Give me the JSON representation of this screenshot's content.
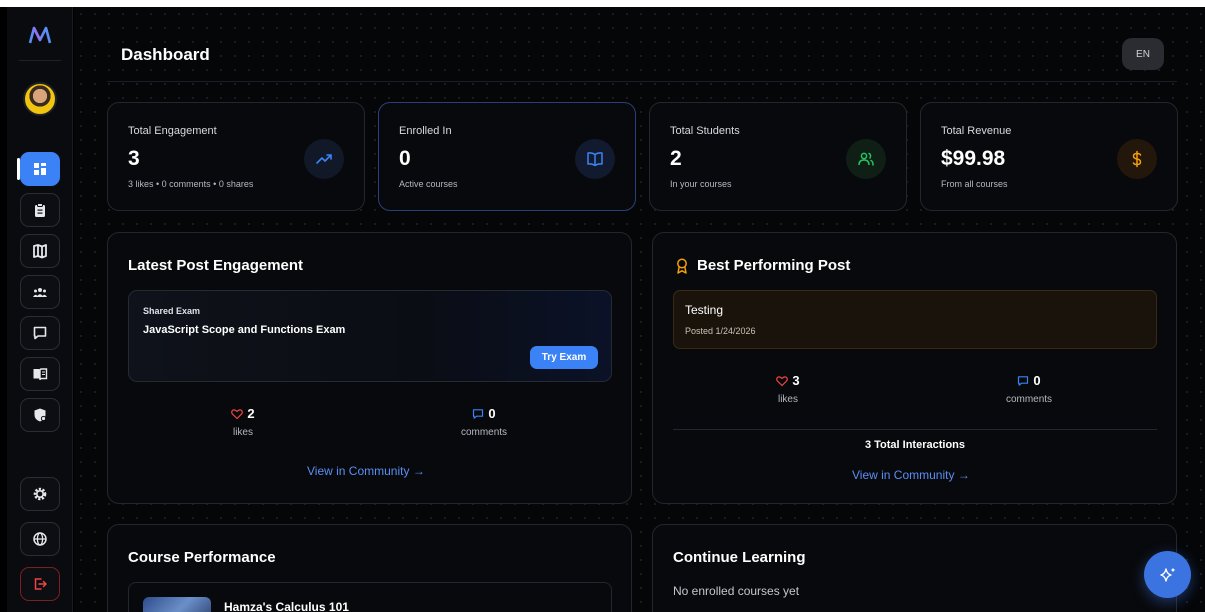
{
  "header": {
    "title": "Dashboard",
    "language": "EN"
  },
  "sidebar": {
    "items": [
      {
        "name": "dashboard",
        "icon": "grid-icon"
      },
      {
        "name": "exams",
        "icon": "clipboard-icon"
      },
      {
        "name": "roadmap",
        "icon": "map-icon"
      },
      {
        "name": "community",
        "icon": "users-icon"
      },
      {
        "name": "messages",
        "icon": "chat-icon"
      },
      {
        "name": "courses",
        "icon": "book-icon"
      },
      {
        "name": "security",
        "icon": "shield-icon"
      }
    ],
    "bottom": [
      {
        "name": "settings",
        "icon": "gear-icon"
      },
      {
        "name": "language",
        "icon": "globe-icon"
      },
      {
        "name": "logout",
        "icon": "logout-icon"
      }
    ]
  },
  "stats": [
    {
      "label": "Total Engagement",
      "value": "3",
      "sub": "3 likes • 0 comments • 0 shares",
      "icon": "trending-up-icon",
      "color": "#3b82f6"
    },
    {
      "label": "Enrolled In",
      "value": "0",
      "sub": "Active courses",
      "icon": "book-open-icon",
      "color": "#3b82f6"
    },
    {
      "label": "Total Students",
      "value": "2",
      "sub": "In your courses",
      "icon": "users-icon",
      "color": "#22c55e"
    },
    {
      "label": "Total Revenue",
      "value": "$99.98",
      "sub": "From all courses",
      "icon": "dollar-icon",
      "color": "#f59e0b"
    }
  ],
  "latest_post": {
    "title": "Latest Post Engagement",
    "type": "Shared Exam",
    "name": "JavaScript Scope and Functions Exam",
    "action": "Try Exam",
    "likes": "2",
    "likes_label": "likes",
    "comments": "0",
    "comments_label": "comments",
    "link": "View in Community →"
  },
  "best_post": {
    "title": "Best Performing Post",
    "name": "Testing",
    "date": "Posted 1/24/2026",
    "likes": "3",
    "likes_label": "likes",
    "comments": "0",
    "comments_label": "comments",
    "total": "3 Total Interactions",
    "link": "View in Community →"
  },
  "course_performance": {
    "title": "Course Performance",
    "courses": [
      {
        "name": "Hamza's Calculus 101"
      }
    ]
  },
  "continue_learning": {
    "title": "Continue Learning",
    "empty": "No enrolled courses yet"
  },
  "colors": {
    "accent": "#3b82f6",
    "like": "#ef4444",
    "award": "#f59e0b",
    "success": "#22c55e"
  }
}
